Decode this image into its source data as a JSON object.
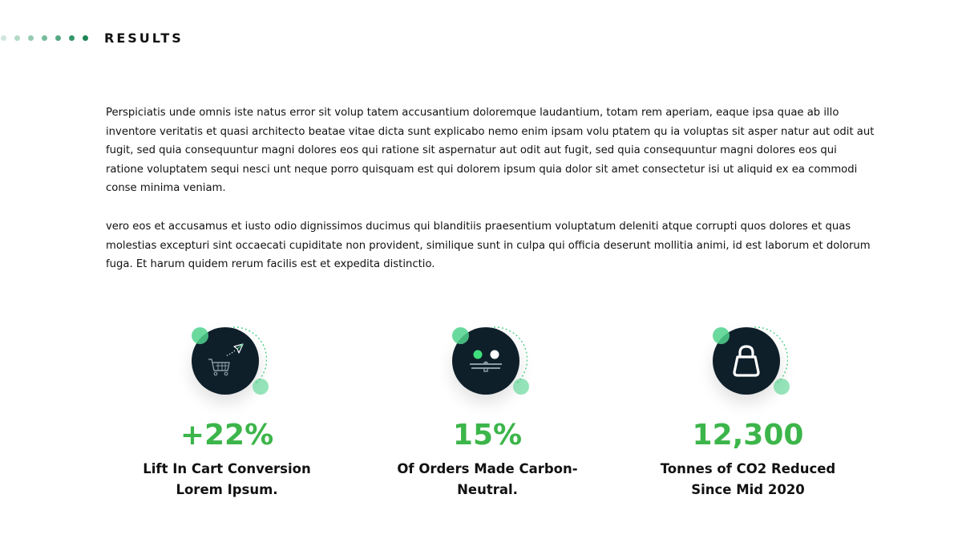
{
  "header": {
    "title": "RESULTS",
    "dot_colors": [
      "#cfe7dc",
      "#b3d9c7",
      "#96cbb2",
      "#76bb9b",
      "#54a982",
      "#359769",
      "#1e8554"
    ]
  },
  "intro": {
    "paragraphs": [
      "Perspiciatis unde omnis iste natus error sit volup tatem accusantium doloremque laudantium, totam rem aperiam, eaque ipsa quae ab illo inventore veritatis et quasi architecto beatae vitae dicta sunt explicabo nemo enim ipsam volu ptatem qu ia voluptas sit asper natur aut odit aut fugit, sed quia consequuntur magni dolores eos qui ratione sit aspernatur aut odit aut fugit, sed quia consequuntur magni dolores eos qui ratione voluptatem sequi nesci unt neque porro quisquam est qui dolorem ipsum quia dolor sit amet consectetur isi ut aliquid ex ea commodi conse minima veniam.",
      "vero eos et accusamus et iusto odio dignissimos ducimus qui blanditiis praesentium voluptatum deleniti atque corrupti quos dolores et quas molestias excepturi sint occaecati cupiditate non provident, similique sunt in culpa qui officia deserunt mollitia animi, id est laborum et dolorum fuga. Et harum quidem rerum facilis est et expedita distinctio."
    ]
  },
  "stats": [
    {
      "icon": "shopping-cart-icon",
      "value": "+22%",
      "label_line1": "Lift In Cart Conversion",
      "label_line2": "Lorem Ipsum."
    },
    {
      "icon": "carbon-balance-icon",
      "value": "15%",
      "label_line1": "Of Orders Made Carbon-",
      "label_line2": "Neutral."
    },
    {
      "icon": "shopping-bag-icon",
      "value": "12,300",
      "label_line1": "Tonnes of CO2 Reduced",
      "label_line2": "Since Mid 2020"
    }
  ],
  "colors": {
    "accent": "#3cb54a",
    "icon_bg": "#0e1f2a",
    "bubble": "#50d28c"
  }
}
